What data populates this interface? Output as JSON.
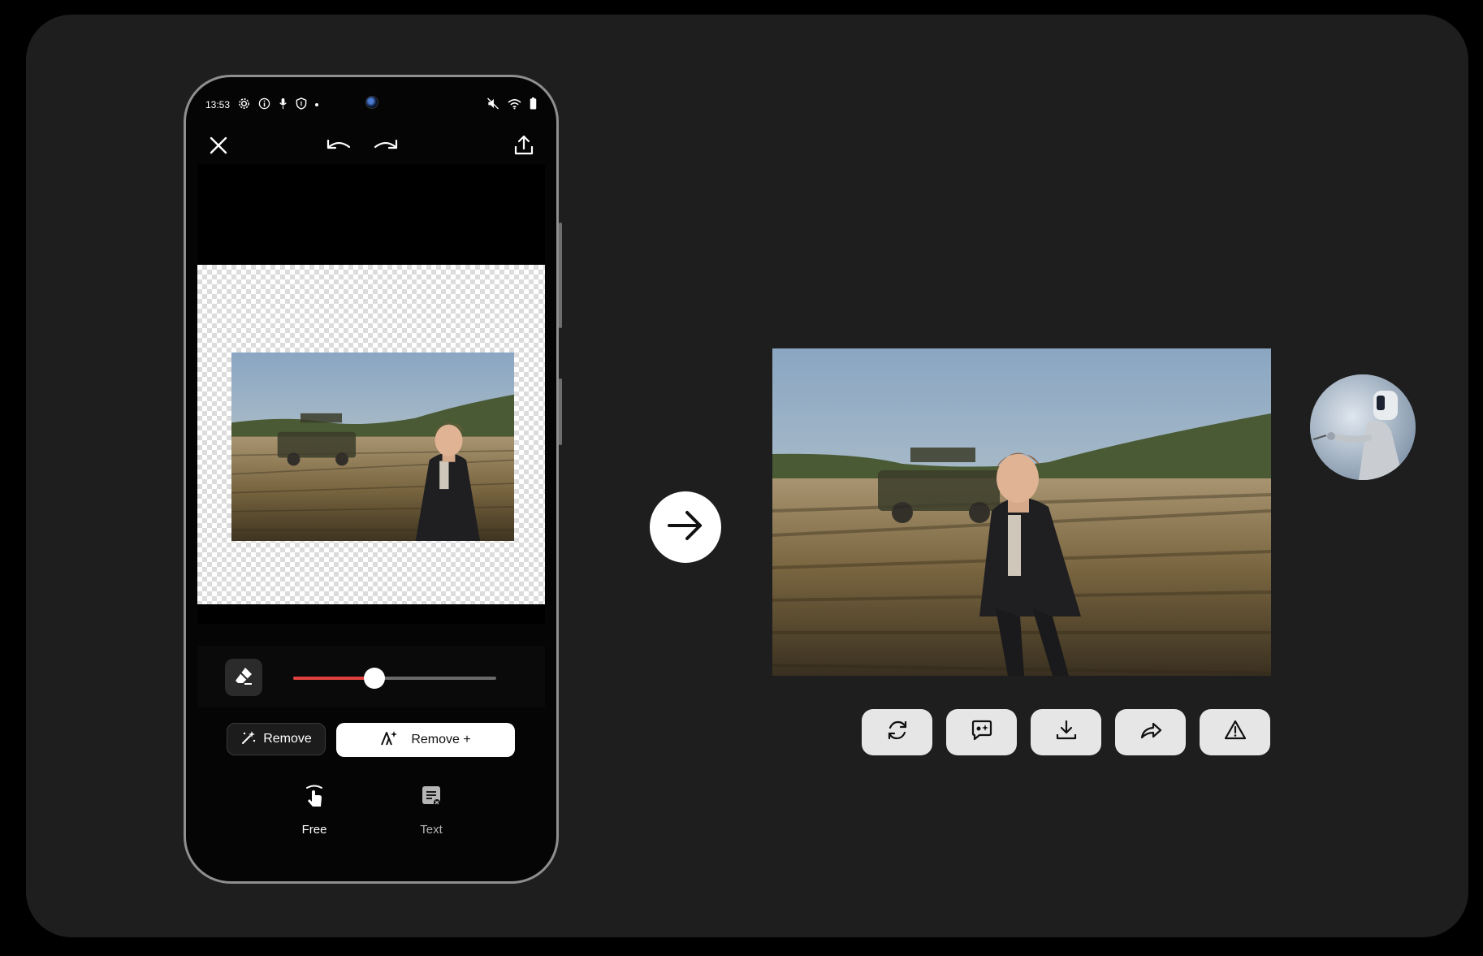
{
  "statusbar": {
    "time": "13:53"
  },
  "editor": {
    "buttons": {
      "remove_label": "Remove",
      "remove_plus_label": "Remove +"
    },
    "tabs": [
      {
        "label": "Free",
        "active": true
      },
      {
        "label": "Text",
        "active": false
      }
    ],
    "brush_size_fraction": 0.4
  },
  "colors": {
    "background": "#1e1e1e",
    "slider_fill": "#e0413f",
    "action_button": "#e6e6e6"
  },
  "icons": {
    "topbar": [
      "close-icon",
      "undo-icon",
      "redo-icon",
      "share-icon"
    ],
    "result_actions": [
      "regenerate-icon",
      "feedback-icon",
      "download-icon",
      "share-icon",
      "report-icon"
    ],
    "transition": "arrow-right-icon"
  }
}
